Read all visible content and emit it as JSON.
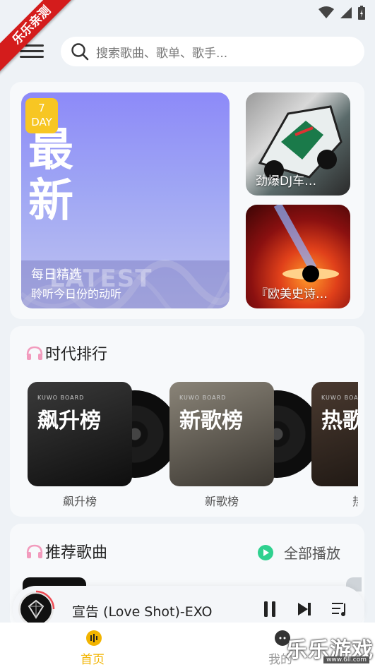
{
  "ribbon": "乐乐亲测",
  "search": {
    "placeholder": "搜索歌曲、歌单、歌手..."
  },
  "featured": {
    "daily": {
      "big_top": "最",
      "big_bottom": "新",
      "badge_num": "7",
      "badge_unit": "DAY",
      "overlay_word": "LATEST",
      "title": "每日精选",
      "subtitle": "聆听今日份的动听"
    },
    "tiles": [
      {
        "label": "劲爆DJ车…"
      },
      {
        "label": "『欧美史诗…"
      }
    ]
  },
  "rankings": {
    "title": "时代排行",
    "items": [
      {
        "board": "KUWO BOARD",
        "big": "飙升榜",
        "caption": "飙升榜"
      },
      {
        "board": "KUWO BOARD",
        "big": "新歌榜",
        "caption": "新歌榜"
      },
      {
        "board": "KUWO BOARD",
        "big": "热歌",
        "caption": "热"
      }
    ]
  },
  "recommend": {
    "title": "推荐歌曲",
    "play_all": "全部播放"
  },
  "player": {
    "song": "宣告 (Love Shot)-EXO"
  },
  "nav": {
    "home": "首页",
    "mine": "我的"
  },
  "watermark": {
    "text": "乐乐游戏",
    "url": "www.6ll.com"
  },
  "colors": {
    "accent_green": "#2fd18f",
    "badge_yellow": "#f7c623",
    "nav_active": "#f2b400"
  }
}
